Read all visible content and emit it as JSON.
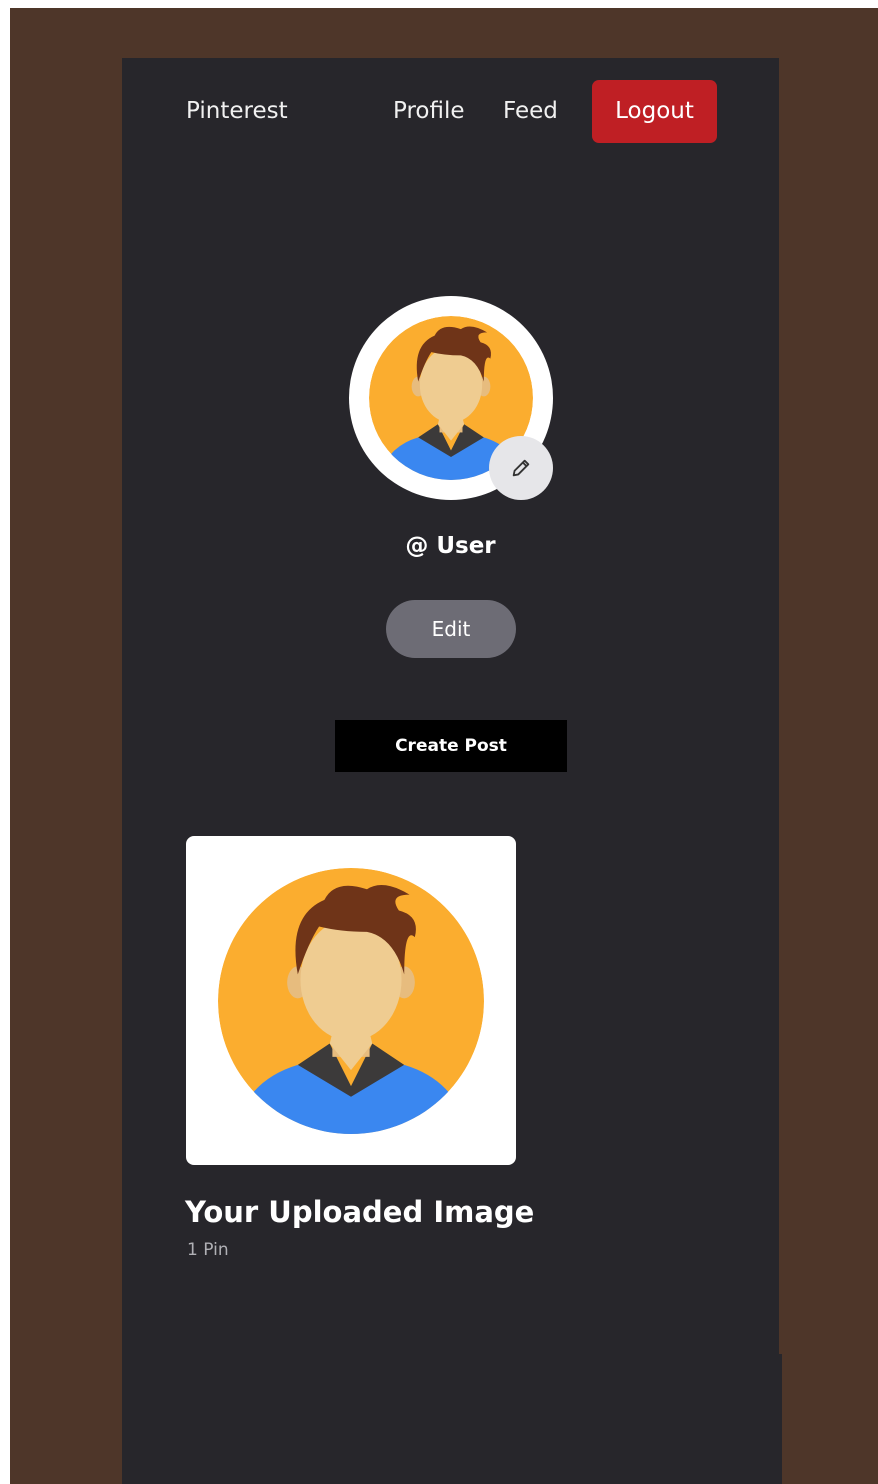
{
  "nav": {
    "brand": "Pinterest",
    "links": [
      {
        "label": "Profile"
      },
      {
        "label": "Feed"
      }
    ],
    "logout_label": "Logout"
  },
  "profile": {
    "username": "@ User",
    "edit_label": "Edit",
    "create_post_label": "Create Post",
    "avatar_icon": "user-avatar-icon",
    "edit_avatar_icon": "pencil-icon"
  },
  "posts": [
    {
      "title": "Your Uploaded Image",
      "count": "1 Pin"
    }
  ],
  "colors": {
    "frame": "#4e3629",
    "panel": "#27262b",
    "logout": "#bf1f24",
    "edit_button": "#6d6c75",
    "avatar_bg": "#fbad2f",
    "shirt": "#3a87f0"
  }
}
